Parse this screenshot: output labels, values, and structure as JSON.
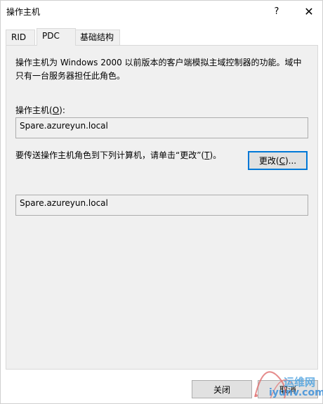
{
  "window": {
    "title": "操作主机",
    "help_label": "?",
    "close_label": "✕"
  },
  "tabs": [
    {
      "label": "RID",
      "active": false
    },
    {
      "label": "PDC",
      "active": true
    },
    {
      "label": "基础结构",
      "active": false
    }
  ],
  "panel": {
    "description": "操作主机为 Windows 2000 以前版本的客户端模拟主域控制器的功能。域中只有一台服务器担任此角色。",
    "operations_master_label": "操作主机(",
    "operations_master_key": "O",
    "operations_master_suffix": "):",
    "current_master": "Spare.azureyun.local",
    "transfer_text_prefix": "要传送操作主机角色到下列计算机，请单击“更改”(",
    "transfer_text_key": "T",
    "transfer_text_suffix": ")。",
    "change_button_prefix": "更改(",
    "change_button_key": "C",
    "change_button_suffix": ")...",
    "target_computer": "Spare.azureyun.local"
  },
  "footer": {
    "close_label": "关闭",
    "cancel_label": "取消"
  },
  "watermark": {
    "text": "运维网",
    "url": "iyunv.com"
  }
}
